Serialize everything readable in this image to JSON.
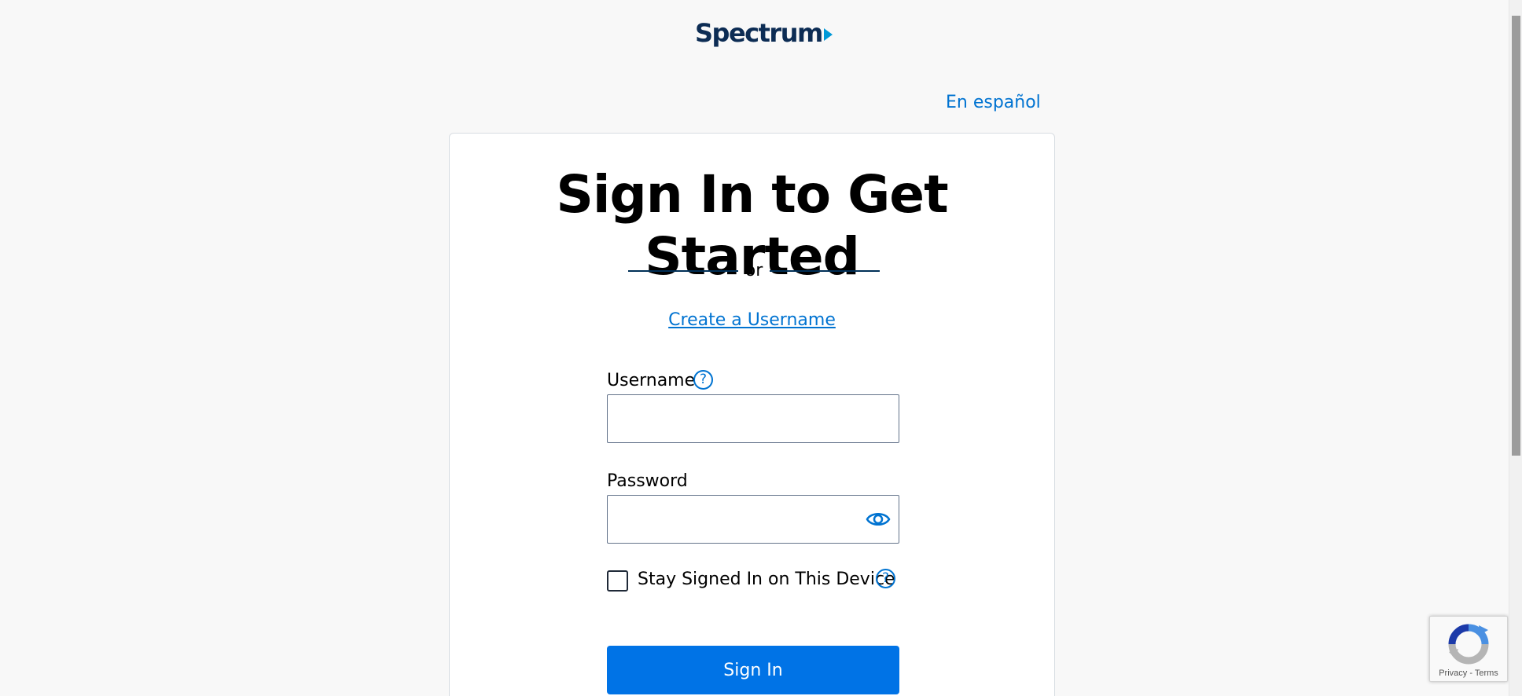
{
  "brand": {
    "logo_text": "Spectrum",
    "logo_color": "#0c2c54",
    "arrow_color": "#0099d8"
  },
  "header": {
    "language_link": "En español"
  },
  "card": {
    "heading": "Sign In to Get Started",
    "divider_text": "or",
    "create_username_link": "Create a Username",
    "username": {
      "label": "Username",
      "value": "",
      "help_icon": "question-circle-icon"
    },
    "password": {
      "label": "Password",
      "value": "",
      "toggle_icon": "eye-icon"
    },
    "stay_signed_in": {
      "label": "Stay Signed In on This Device",
      "checked": false,
      "help_icon": "question-circle-icon"
    },
    "sign_in_button": "Sign In"
  },
  "recaptcha": {
    "privacy_link": "Privacy",
    "separator": "-",
    "terms_link": "Terms"
  },
  "colors": {
    "link": "#0073d1",
    "primary_button": "#0073e6",
    "page_background": "#f8f8f8"
  }
}
